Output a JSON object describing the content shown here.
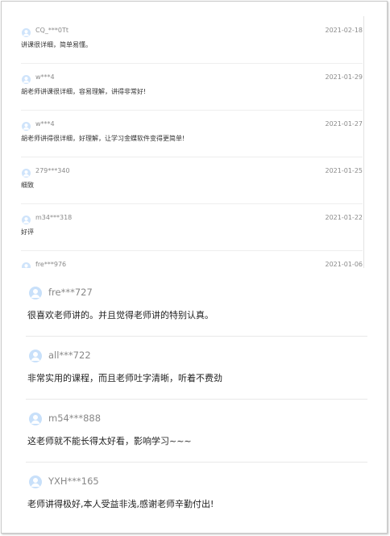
{
  "top_reviews": [
    {
      "name": "CQ_***0Tt",
      "date": "2021-02-18",
      "text": "讲课很详细，简单易懂。"
    },
    {
      "name": "w***4",
      "date": "2021-01-29",
      "text": "胡老师讲课很详细，容易理解，讲得非常好!"
    },
    {
      "name": "w***4",
      "date": "2021-01-27",
      "text": "胡老师讲得很详细，好理解，让学习金蝶软件变得更简单!"
    },
    {
      "name": "279***340",
      "date": "2021-01-25",
      "text": "细致"
    },
    {
      "name": "m34***318",
      "date": "2021-01-22",
      "text": "好评"
    },
    {
      "name": "fre***976",
      "date": "2021-01-06",
      "text": ""
    }
  ],
  "bottom_reviews": [
    {
      "name": "fre***727",
      "text": "很喜欢老师讲的。并且觉得老师讲的特别认真。"
    },
    {
      "name": "all***722",
      "text": "非常实用的课程，而且老师吐字清晰，听着不费劲"
    },
    {
      "name": "m54***888",
      "text": "这老师就不能长得太好看，影响学习~~~"
    },
    {
      "name": "YXH***165",
      "text": "老师讲得极好,本人受益非浅,感谢老师辛勤付出!"
    }
  ],
  "icons": {
    "avatar": "user-avatar-icon"
  },
  "colors": {
    "avatar_bg": "#c8e0fa",
    "avatar_fg": "#ffffff"
  }
}
